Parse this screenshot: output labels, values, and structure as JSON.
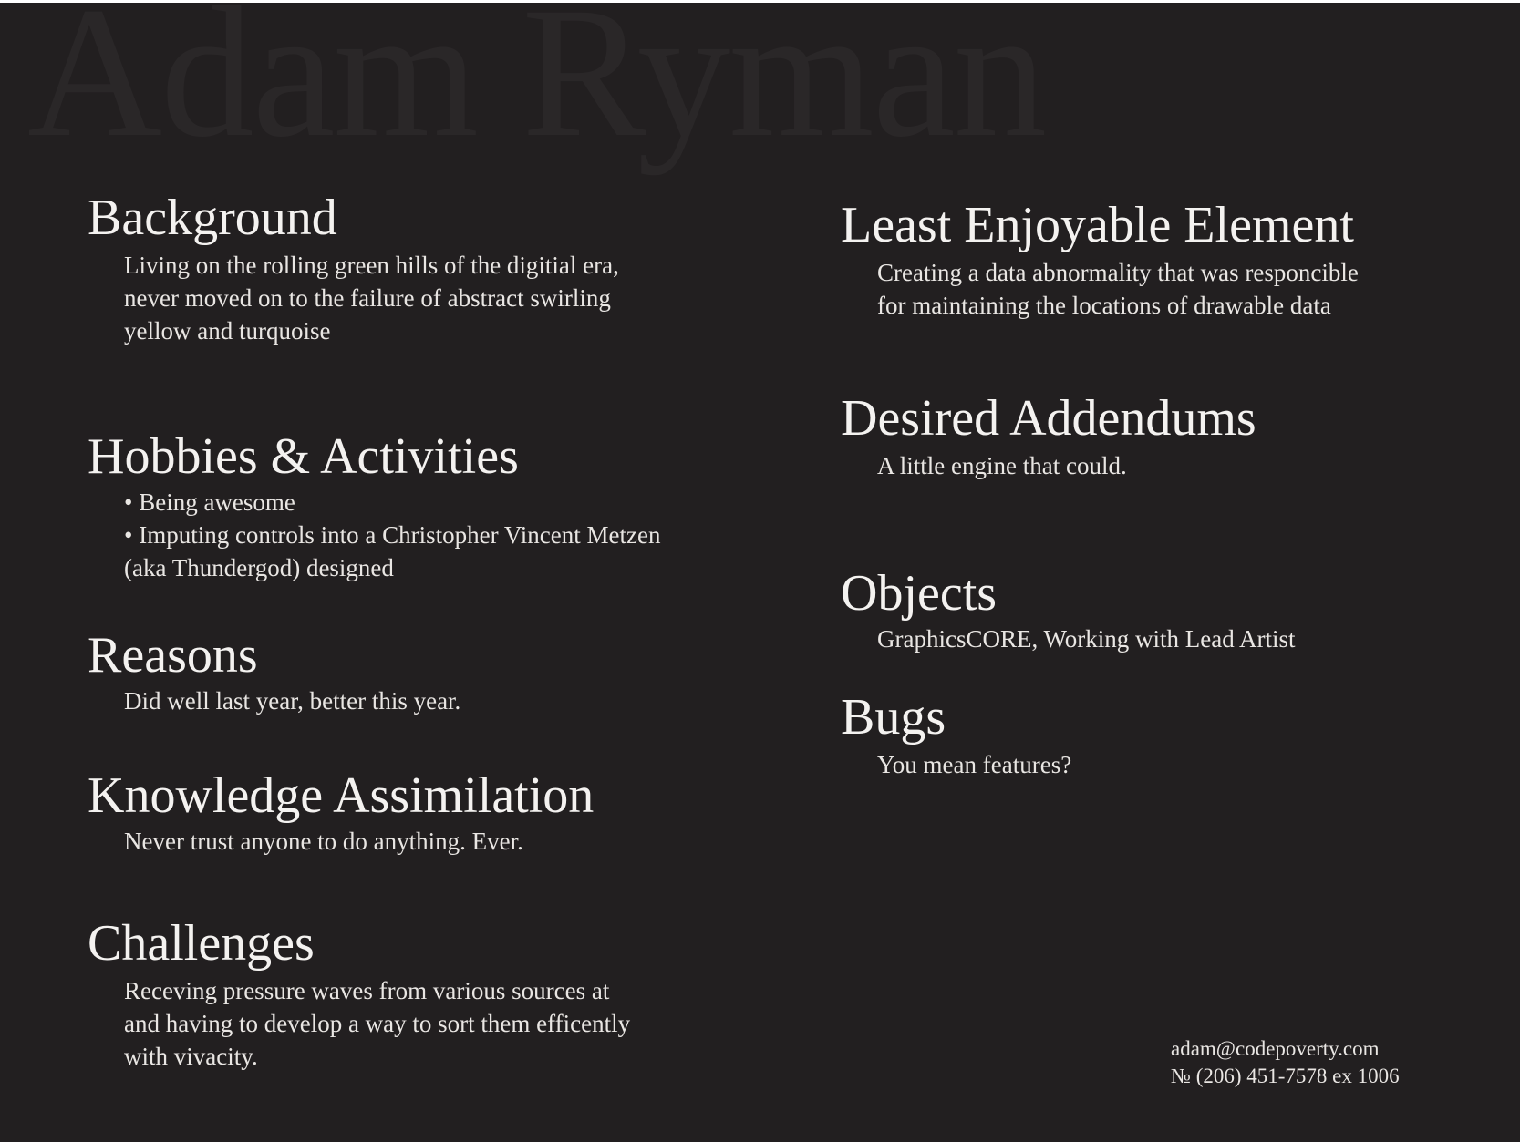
{
  "watermark": "Adam Ryman",
  "left_column": {
    "background": {
      "heading": "Background",
      "lines": [
        "Living on the rolling green hills of the digitial era,",
        "never moved on to the failure of abstract swirling",
        "yellow and turquoise"
      ]
    },
    "hobbies": {
      "heading": "Hobbies & Activities",
      "lines": [
        "• Being awesome",
        "• Imputing controls into a Christopher Vincent Metzen",
        "(aka Thundergod) designed"
      ]
    },
    "reasons": {
      "heading": "Reasons",
      "lines": [
        "Did well last year, better this year."
      ]
    },
    "knowledge": {
      "heading": "Knowledge Assimilation",
      "lines": [
        "Never trust anyone to do anything. Ever."
      ]
    },
    "challenges": {
      "heading": "Challenges",
      "lines": [
        "Receving pressure waves from various sources at",
        "and having to develop a way to sort them efficently",
        "with vivacity."
      ]
    }
  },
  "right_column": {
    "least_enjoyable": {
      "heading": "Least Enjoyable Element",
      "lines": [
        "Creating a data abnormality that was responcible",
        "for maintaining the locations of drawable data"
      ]
    },
    "addendums": {
      "heading": "Desired Addendums",
      "lines": [
        "A little engine that could."
      ]
    },
    "objects": {
      "heading": "Objects",
      "lines": [
        "GraphicsCORE, Working with Lead Artist"
      ]
    },
    "bugs": {
      "heading": "Bugs",
      "lines": [
        "You mean features?"
      ]
    }
  },
  "contact": {
    "email": "adam@codepoverty.com",
    "phone": "№ (206) 451-7578 ex 1006"
  },
  "colors": {
    "background": "#221f20",
    "text": "#f2f0ee",
    "watermark": "#2a2728"
  }
}
